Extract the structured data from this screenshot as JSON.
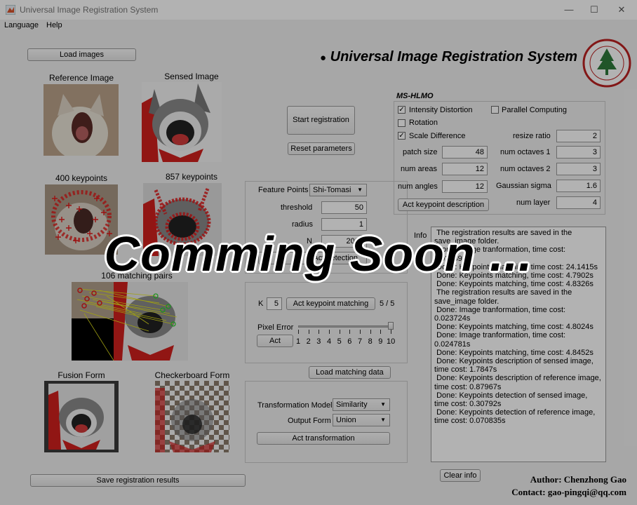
{
  "window": {
    "title": "Universal Image Registration System",
    "minimize": "—",
    "maximize": "☐",
    "close": "✕"
  },
  "menu": [
    {
      "label": "Language"
    },
    {
      "label": "Help"
    }
  ],
  "header": {
    "bullet": "●",
    "title": "Universal Image Registration System"
  },
  "buttons": {
    "load_images": "Load images",
    "start_registration": "Start registration",
    "reset_parameters": "Reset parameters",
    "act_keypoint_description": "Act keypoint description",
    "act_keypoint_matching": "Act keypoint matching",
    "act": "Act",
    "load_matching_data": "Load matching data",
    "act_transformation": "Act transformation",
    "save_registration_results": "Save registration results",
    "clear_info": "Clear info"
  },
  "images": {
    "reference": "Reference Image",
    "sensed": "Sensed Image",
    "ref_keypoints": "400 keypoints",
    "sen_keypoints": "857 keypoints",
    "matching": "106 matching pairs",
    "fusion": "Fusion Form",
    "checkerboard": "Checkerboard Form"
  },
  "features": {
    "feature_points_label": "Feature Points",
    "feature_points_value": "Shi-Tomasi",
    "threshold_label": "threshold",
    "threshold_value": "50",
    "radius_label": "radius",
    "radius_value": "1",
    "n_label": "N",
    "n_value": "2000",
    "hidden_button": "Act detection"
  },
  "mshlmo": {
    "title": "MS-HLMO",
    "intensity_distortion": "Intensity Distortion",
    "intensity_checked": true,
    "parallel_computing": "Parallel Computing",
    "parallel_checked": false,
    "rotation": "Rotation",
    "rotation_checked": false,
    "scale_difference": "Scale Difference",
    "scale_checked": true,
    "resize_ratio_label": "resize ratio",
    "resize_ratio": "2",
    "patch_size_label": "patch size",
    "patch_size": "48",
    "num_octaves1_label": "num octaves 1",
    "num_octaves1": "3",
    "num_areas_label": "num areas",
    "num_areas": "12",
    "num_octaves2_label": "num octaves 2",
    "num_octaves2": "3",
    "num_angles_label": "num angles",
    "num_angles": "12",
    "gaussian_sigma_label": "Gaussian sigma",
    "gaussian_sigma": "1.6",
    "num_layer_label": "num layer",
    "num_layer": "4"
  },
  "matching": {
    "k_label": "K",
    "k_value": "5",
    "progress": "5 / 5",
    "pixel_error_label": "Pixel Error",
    "slider_value": 10,
    "slider_ticks": [
      "1",
      "2",
      "3",
      "4",
      "5",
      "6",
      "7",
      "8",
      "9",
      "10"
    ]
  },
  "transform": {
    "model_label": "Transformation Model",
    "model_value": "Similarity",
    "output_label": "Output Form",
    "output_value": "Union"
  },
  "info": {
    "label": "Info",
    "lines": [
      " The registration results are saved in the save_image folder.",
      " Done: Image tranformation, time cost: 0.023891s",
      " Done: Keypoints matching, time cost: 24.1415s",
      " Done: Keypoints matching, time cost: 4.7902s",
      " Done: Keypoints matching, time cost: 4.8326s",
      " The registration results are saved in the save_image folder.",
      " Done: Image tranformation, time cost: 0.023724s",
      " Done: Keypoints matching, time cost: 4.8024s",
      " Done: Image tranformation, time cost: 0.024781s",
      " Done: Keypoints matching, time cost: 4.8452s",
      " Done: Keypoints description of sensed image, time cost: 1.7847s",
      " Done: Keypoints description of reference image, time cost: 0.87967s",
      " Done: Keypoints detection of sensed image, time cost: 0.30792s",
      " Done: Keypoints detection of reference image, time cost: 0.070835s"
    ]
  },
  "footer": {
    "author": "Author: Chenzhong Gao",
    "contact": "Contact: gao-pingqi@qq.com"
  },
  "overlay": {
    "text": "Comming Soon ..."
  },
  "colors": {
    "accent_red": "#d0201e",
    "keypoint_yellow": "#e6e61a",
    "logo_green": "#2f7a3b"
  }
}
